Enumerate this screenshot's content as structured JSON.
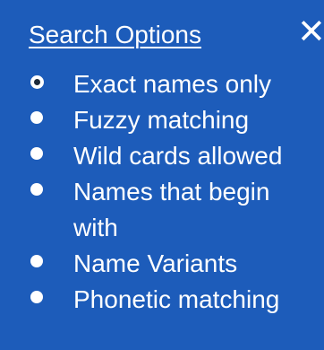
{
  "panel": {
    "title": "Search Options",
    "close_icon": "close-icon",
    "selected_index": 0
  },
  "options": [
    {
      "label": "Exact names only",
      "selected": true
    },
    {
      "label": "Fuzzy matching",
      "selected": false
    },
    {
      "label": "Wild cards allowed",
      "selected": false
    },
    {
      "label": "Names that begin with",
      "selected": false
    },
    {
      "label": "Name Variants",
      "selected": false
    },
    {
      "label": "Phonetic matching",
      "selected": false
    }
  ],
  "colors": {
    "panel_background": "#1d5cba",
    "text": "#ffffff",
    "selected_radio_center": "#1d2a3a"
  }
}
